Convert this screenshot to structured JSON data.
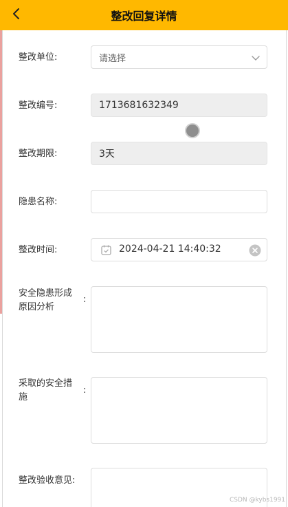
{
  "header": {
    "title": "整改回复详情",
    "back_icon": "chevron-left-icon",
    "color": "#ffb800"
  },
  "form": {
    "unit": {
      "label": "整改单位:",
      "placeholder": "请选择"
    },
    "number": {
      "label": "整改编号:",
      "value": "1713681632349"
    },
    "deadline": {
      "label": "整改期限:",
      "value": "3天"
    },
    "hazard_name": {
      "label": "隐患名称:",
      "value": ""
    },
    "rectify_time": {
      "label": "整改时间:",
      "value": "2024-04-21 14:40:32"
    },
    "cause_analysis": {
      "label": "安全隐患形成原因分析",
      "colon": ":",
      "value": ""
    },
    "measures": {
      "label": "采取的安全措施",
      "colon": ":",
      "value": ""
    },
    "acceptance": {
      "label": "整改验收意见:",
      "value": ""
    }
  },
  "watermark": "CSDN @kybs1991"
}
